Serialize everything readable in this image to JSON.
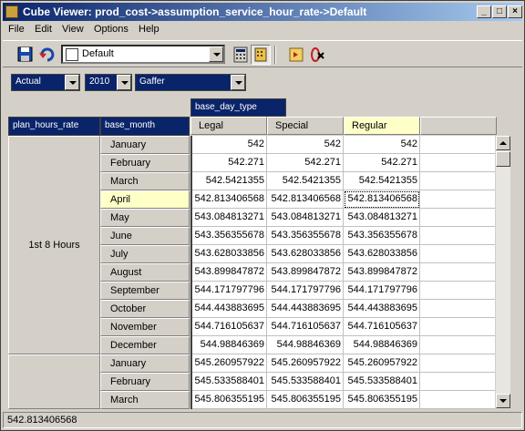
{
  "window": {
    "title": "Cube Viewer: prod_cost->assumption_service_hour_rate->Default"
  },
  "menu": {
    "items": [
      "File",
      "Edit",
      "View",
      "Options",
      "Help"
    ]
  },
  "toolbar": {
    "view_name": "Default"
  },
  "filters": [
    {
      "value": "Actual"
    },
    {
      "value": "2010"
    },
    {
      "value": "Gaffer"
    }
  ],
  "grid": {
    "column_dimension": "base_day_type",
    "row_dimensions": [
      "plan_hours_rate",
      "base_month"
    ],
    "columns": [
      "Legal",
      "Special",
      "Regular"
    ],
    "selected_column": "Regular",
    "groups": [
      {
        "label": "1st 8 Hours"
      },
      {
        "label": ""
      }
    ],
    "rows": [
      {
        "month": "January",
        "values": [
          "542",
          "542",
          "542"
        ]
      },
      {
        "month": "February",
        "values": [
          "542.271",
          "542.271",
          "542.271"
        ]
      },
      {
        "month": "March",
        "values": [
          "542.5421355",
          "542.5421355",
          "542.5421355"
        ]
      },
      {
        "month": "April",
        "values": [
          "542.813406568",
          "542.813406568",
          "542.813406568"
        ]
      },
      {
        "month": "May",
        "values": [
          "543.084813271",
          "543.084813271",
          "543.084813271"
        ]
      },
      {
        "month": "June",
        "values": [
          "543.356355678",
          "543.356355678",
          "543.356355678"
        ]
      },
      {
        "month": "July",
        "values": [
          "543.628033856",
          "543.628033856",
          "543.628033856"
        ]
      },
      {
        "month": "August",
        "values": [
          "543.899847872",
          "543.899847872",
          "543.899847872"
        ]
      },
      {
        "month": "September",
        "values": [
          "544.171797796",
          "544.171797796",
          "544.171797796"
        ]
      },
      {
        "month": "October",
        "values": [
          "544.443883695",
          "544.443883695",
          "544.443883695"
        ]
      },
      {
        "month": "November",
        "values": [
          "544.716105637",
          "544.716105637",
          "544.716105637"
        ]
      },
      {
        "month": "December",
        "values": [
          "544.98846369",
          "544.98846369",
          "544.98846369"
        ]
      },
      {
        "month": "January",
        "values": [
          "545.260957922",
          "545.260957922",
          "545.260957922"
        ]
      },
      {
        "month": "February",
        "values": [
          "545.533588401",
          "545.533588401",
          "545.533588401"
        ]
      },
      {
        "month": "March",
        "values": [
          "545.806355195",
          "545.806355195",
          "545.806355195"
        ]
      }
    ],
    "selected_row_month": "April"
  },
  "status": {
    "text": "542.813406568"
  }
}
